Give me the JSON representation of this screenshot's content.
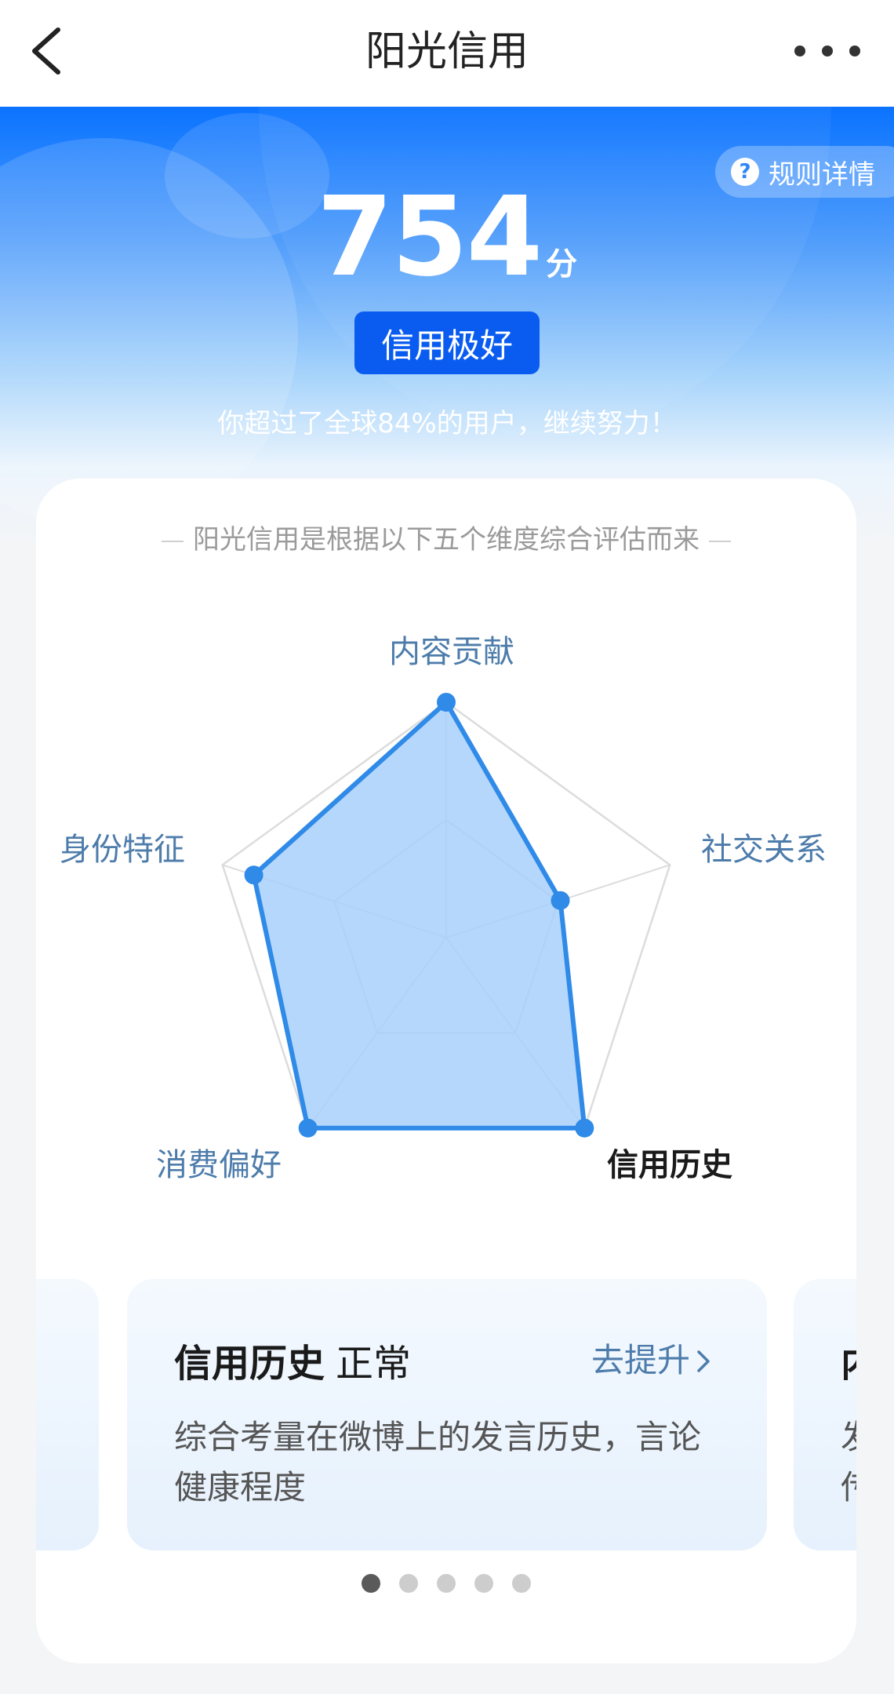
{
  "nav": {
    "title": "阳光信用",
    "back_icon": "chevron-left-icon",
    "more_icon": "more-horizontal-icon"
  },
  "hero": {
    "rules_label": "规则详情",
    "rules_icon": "question-circle-icon",
    "score": "754",
    "score_unit": "分",
    "level": "信用极好",
    "rank_text": "你超过了全球84%的用户，继续努力！"
  },
  "card": {
    "subtitle": "阳光信用是根据以下五个维度综合评估而来",
    "radar": {
      "axes": [
        "内容贡献",
        "社交关系",
        "信用历史",
        "消费偏好",
        "身份特征"
      ],
      "active_axis": "信用历史",
      "values": [
        1.0,
        0.51,
        1.0,
        1.0,
        0.86
      ],
      "max": 1.0,
      "grid_levels": 2
    },
    "dimension": {
      "title": "信用历史",
      "status": "正常",
      "improve_label": "去提升",
      "description": "综合考量在微博上的发言历史，言论健康程度"
    },
    "peek": {
      "title": "内",
      "desc": "发\n传"
    },
    "page_count": 5,
    "active_page": 0
  },
  "colors": {
    "accent": "#2f86f6",
    "badge": "#0a5cf0",
    "axis_label": "#4d7cab",
    "radar_fill": "#a8d0fa",
    "radar_stroke": "#2f8ae8"
  }
}
